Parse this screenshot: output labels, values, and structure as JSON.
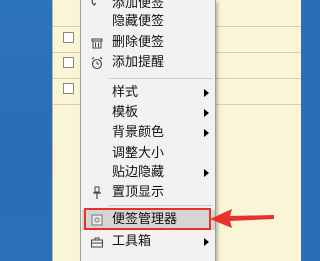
{
  "menu": {
    "items": [
      {
        "label": "添加便签",
        "icon": "add-note-icon",
        "submenu": false
      },
      {
        "label": "隐藏便签",
        "icon": "",
        "submenu": false
      },
      {
        "label": "删除便签",
        "icon": "trash-icon",
        "submenu": false
      },
      {
        "label": "添加提醒",
        "icon": "alarm-clock-icon",
        "submenu": false
      },
      {
        "label": "样式",
        "icon": "",
        "submenu": true
      },
      {
        "label": "模板",
        "icon": "",
        "submenu": true
      },
      {
        "label": "背景颜色",
        "icon": "",
        "submenu": true
      },
      {
        "label": "调整大小",
        "icon": "",
        "submenu": false
      },
      {
        "label": "贴边隐藏",
        "icon": "",
        "submenu": true
      },
      {
        "label": "置顶显示",
        "icon": "pin-icon",
        "submenu": false
      },
      {
        "label": "便签管理器",
        "icon": "manager-icon",
        "submenu": false,
        "highlighted": true
      },
      {
        "label": "工具箱",
        "icon": "toolbox-icon",
        "submenu": true
      }
    ]
  },
  "colors": {
    "desktop": "#2a6fb6",
    "note": "#fbf5d7",
    "menu_bg": "#f2f2f2",
    "highlight": "#d5d5d5",
    "annotation": "#e8312b"
  }
}
